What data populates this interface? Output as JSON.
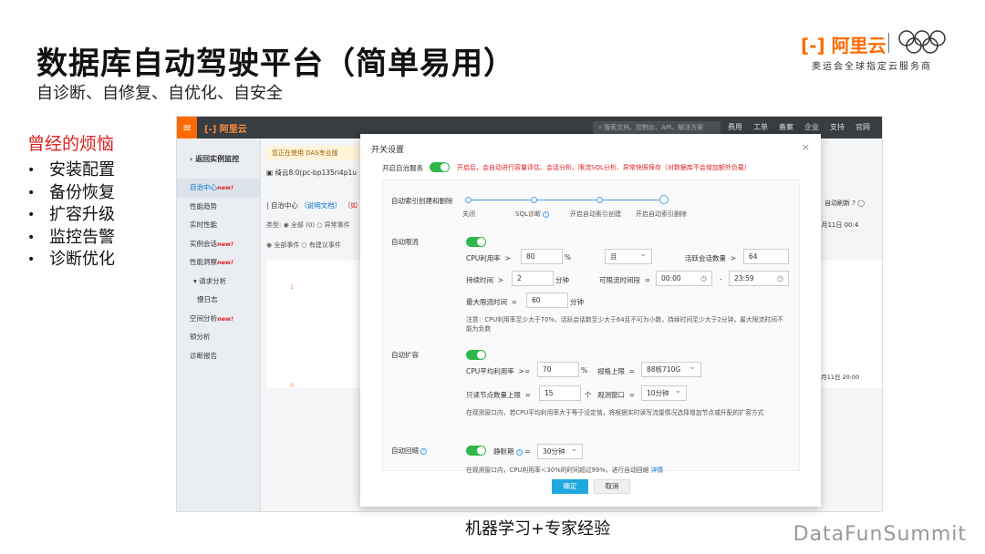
{
  "slide": {
    "title": "数据库自动驾驶平台（简单易用）",
    "subtitle": "自诊断、自修复、自优化、自安全",
    "brand_logo": "阿里云",
    "brand_tag": "奥运会全球指定云服务商",
    "pain_title": "曾经的烦恼",
    "pain_items": [
      "安装配置",
      "备份恢复",
      "扩容升级",
      "监控告警",
      "诊断优化"
    ],
    "caption": "机器学习+专家经验",
    "footer_brand": "DataFunSummit"
  },
  "console": {
    "logo": "阿里云",
    "search_placeholder": "搜索文档、控制台、API、解决方案",
    "top_nav": [
      "费用",
      "工单",
      "备案",
      "企业",
      "支持",
      "官网"
    ],
    "back": "返回实例监控",
    "sidebar": [
      {
        "label": "自治中心",
        "new": "new!"
      },
      {
        "label": "性能趋势",
        "new": ""
      },
      {
        "label": "实时性能",
        "new": ""
      },
      {
        "label": "实例会话",
        "new": "new!"
      },
      {
        "label": "性能洞察",
        "new": "new!"
      },
      {
        "label": "▾ 请求分析",
        "new": ""
      },
      {
        "label": "慢日志",
        "new": ""
      },
      {
        "label": "空间分析",
        "new": "new!"
      },
      {
        "label": "锁分析",
        "new": ""
      },
      {
        "label": "诊断报告",
        "new": ""
      }
    ],
    "notice": "您正在使用 DAS专业版",
    "instance": "绮云8.0(pc-bp135ri4p1u",
    "breadcrumb": {
      "a": "| 自治中心",
      "b": "（说明文档）",
      "c": "（如"
    },
    "filter1": "类型: ◉ 全部 (0) ○ 异常事件",
    "filter2": "◉ 全部事件 ○ 有建议事件",
    "refresh": "自动刷新",
    "date1": "8月11日 00:4",
    "date2": "8月11日 20:00",
    "axis_y": [
      "1",
      "0"
    ]
  },
  "modal": {
    "title": "开关设置",
    "close": "×",
    "autonomy_label": "开启自治服务",
    "autonomy_note": "开启后，会自动进行容量评估、会话分析、限流SQL分析、异常快照保存（对数据库不会增加额外负载）",
    "index_label": "自动索引创建和删除",
    "index_options": [
      "关闭",
      "SQL诊断",
      "开启自动索引创建",
      "开启自动索引删除"
    ],
    "throttle": {
      "label": "自动限流",
      "cpu_label": "CPU利用率",
      "gt": ">",
      "cpu_value": "80",
      "percent": "%",
      "and": "且",
      "sessions_label": "活跃会话数量",
      "sessions_value": "64",
      "duration_label": "持续时间",
      "duration_value": "2",
      "minute": "分钟",
      "window_label": "可限流时间段",
      "eq": "=",
      "start": "00:00",
      "dash": "-",
      "end": "23:59",
      "max_label": "最大限流时间",
      "max_value": "60",
      "note": "注意：CPU利用率至少大于70%、活跃会话数至少大于64且不可为小数，持续时间至少大于2分钟，最大限流时间不能为负数"
    },
    "scale": {
      "label": "自动扩容",
      "cpu_label": "CPU平均利用率",
      "ge": ">=",
      "cpu_value": "70",
      "percent": "%",
      "spec_label": "规格上限",
      "eq": "=",
      "spec_value": "88核710G",
      "ro_label": "只读节点数量上限",
      "ro_value": "15",
      "unit": "个",
      "window_label": "观测窗口",
      "window_value": "10分钟",
      "note": "在观测窗口内，若CPU平均利用率大于等于设定值，将根据实时读写流量情况选择增加节点或升配的扩容方式"
    },
    "shrink": {
      "label": "自动回缩",
      "quiet_label": "静默期",
      "eq": "=",
      "quiet_value": "30分钟",
      "note": "在观测窗口内，CPU利用率＜30%的时间超过99%，进行自动回缩",
      "detail": "详情"
    },
    "ok": "确定",
    "cancel": "取消"
  }
}
